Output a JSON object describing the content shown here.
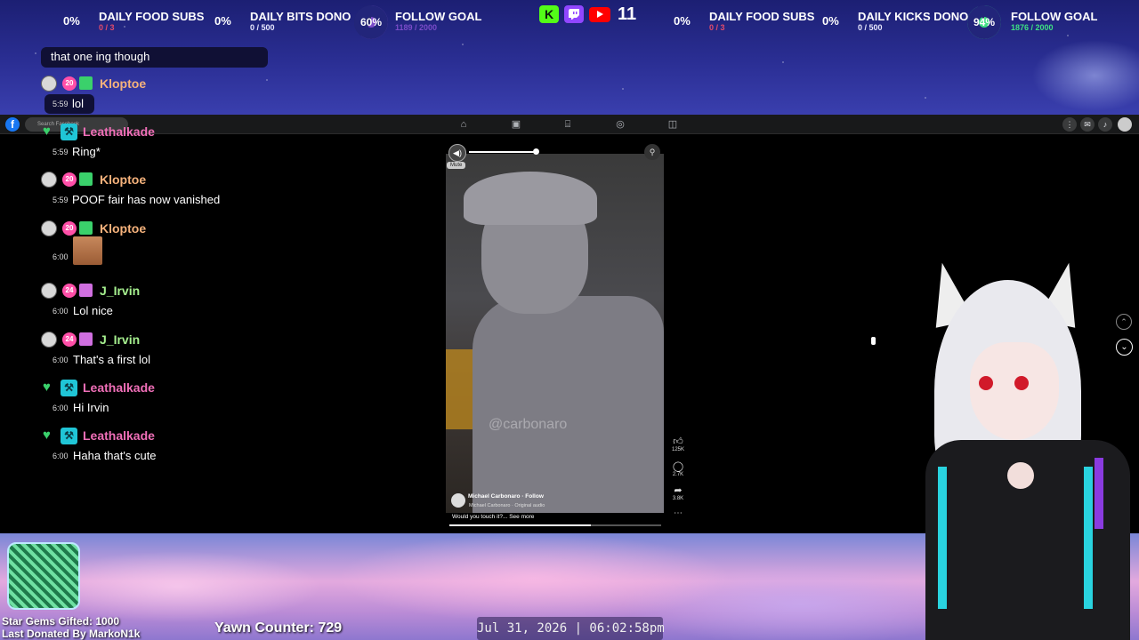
{
  "goals": [
    {
      "pct": "0%",
      "name": "DAILY FOOD SUBS",
      "sub": "0 / 3"
    },
    {
      "pct": "0%",
      "name": "DAILY BITS DONO",
      "sub": "0 / 500"
    },
    {
      "pct": "60%",
      "name": "FOLLOW GOAL",
      "sub": "1189 / 2000",
      "progress": 0.6
    },
    {
      "pct": "0%",
      "name": "DAILY FOOD SUBS",
      "sub": "0 / 3"
    },
    {
      "pct": "0%",
      "name": "DAILY KICKS DONO",
      "sub": "0 / 500"
    },
    {
      "pct": "94%",
      "name": "FOLLOW GOAL",
      "sub": "1876 / 2000",
      "progress": 0.94
    }
  ],
  "platforms": {
    "kick": "K",
    "viewers": "11"
  },
  "chat": {
    "prev_message": "that one ing though",
    "entries": [
      {
        "user": "Kloptoe",
        "sub_months": "20",
        "time": "5:59",
        "message": "lol"
      },
      {
        "user": "Leathalkade",
        "time": "5:59",
        "message": "Ring*"
      },
      {
        "user": "Kloptoe",
        "sub_months": "20",
        "time": "5:59",
        "message": "POOF fair has now vanished"
      },
      {
        "user": "Kloptoe",
        "sub_months": "20",
        "time": "6:00",
        "message": ""
      },
      {
        "user": "J_Irvin",
        "sub_months": "24",
        "time": "6:00",
        "message": "Lol nice"
      },
      {
        "user": "J_Irvin",
        "sub_months": "24",
        "time": "6:00",
        "message": "That's a first lol"
      },
      {
        "user": "Leathalkade",
        "time": "6:00",
        "message": "Hi Irvin"
      },
      {
        "user": "Leathalkade",
        "time": "6:00",
        "message": "Haha that's cute"
      }
    ]
  },
  "facebook": {
    "logo": "f",
    "search_placeholder": "Search Facebook"
  },
  "reel": {
    "mute_label": "Mute",
    "watermark": "@carbonaro",
    "author": "Michael Carbonaro",
    "follow": "Follow",
    "audio": "Michael Carbonaro · Original audio",
    "caption": "Would you touch it?... See more",
    "likes": "125K",
    "comments": "2.7K",
    "shares": "3.8K",
    "progress": 0.67
  },
  "bottom": {
    "gems_gifted": "Star Gems Gifted: 1000",
    "last_donated": "Last Donated By MarkoN1k",
    "yawn_counter": "Yawn Counter: 729",
    "clock": "Jul 31, 2026 | 06:02:58pm"
  },
  "colors": {
    "kick": "#53fc18",
    "twitch": "#9146ff",
    "youtube": "#ff0000",
    "facebook": "#1877f2",
    "goal_ring_green": "#3ee083",
    "goal_ring_purple": "#7b4cc9"
  }
}
